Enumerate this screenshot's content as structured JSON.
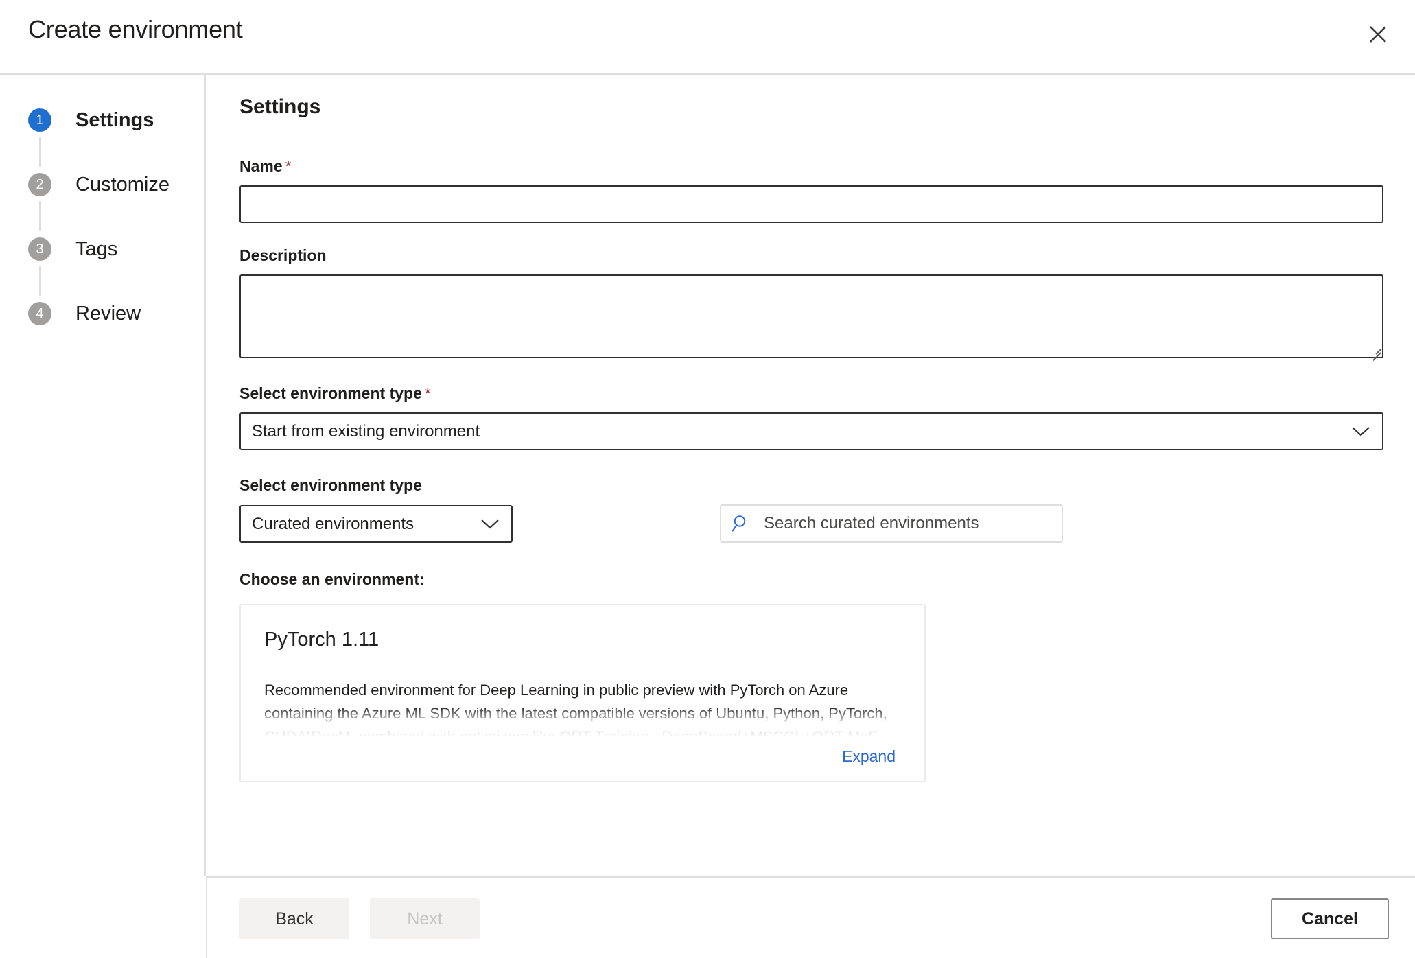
{
  "header": {
    "title": "Create environment",
    "close_icon": "close-icon"
  },
  "sidebar": {
    "steps": [
      {
        "number": "1",
        "label": "Settings",
        "state": "active"
      },
      {
        "number": "2",
        "label": "Customize",
        "state": "inactive"
      },
      {
        "number": "3",
        "label": "Tags",
        "state": "inactive"
      },
      {
        "number": "4",
        "label": "Review",
        "state": "inactive"
      }
    ]
  },
  "main": {
    "section_title": "Settings",
    "name_field": {
      "label": "Name",
      "required_marker": "*",
      "value": "",
      "placeholder": ""
    },
    "description_field": {
      "label": "Description",
      "value": "",
      "placeholder": ""
    },
    "environment_type_primary": {
      "label": "Select environment type",
      "required_marker": "*",
      "selected": "Start from existing environment",
      "chevron_icon": "chevron-down-icon"
    },
    "environment_type_secondary": {
      "label": "Select environment type",
      "selected": "Curated environments",
      "chevron_icon": "chevron-down-icon"
    },
    "search": {
      "placeholder": "Search curated environments",
      "value": "",
      "icon": "search-icon"
    },
    "choose_label": "Choose an environment:",
    "environment_card": {
      "title": "PyTorch 1.11",
      "description": "Recommended environment for Deep Learning in public preview with PyTorch on Azure containing the Azure ML SDK with the latest compatible versions of Ubuntu, Python, PyTorch, CUDA\\RocM, combined with optimizers like ORT Training,+DeepSpeed+MSCCL+ORT MoE and more.",
      "expand_label": "Expand"
    }
  },
  "footer": {
    "back_label": "Back",
    "next_label": "Next",
    "cancel_label": "Cancel"
  },
  "colors": {
    "accent_blue": "#1f6fd0",
    "link_blue": "#2a68d8",
    "required_red": "#a4262c",
    "step_inactive_gray": "#a19f9d",
    "border_gray": "#e1dfdd",
    "input_border": "#323130"
  }
}
